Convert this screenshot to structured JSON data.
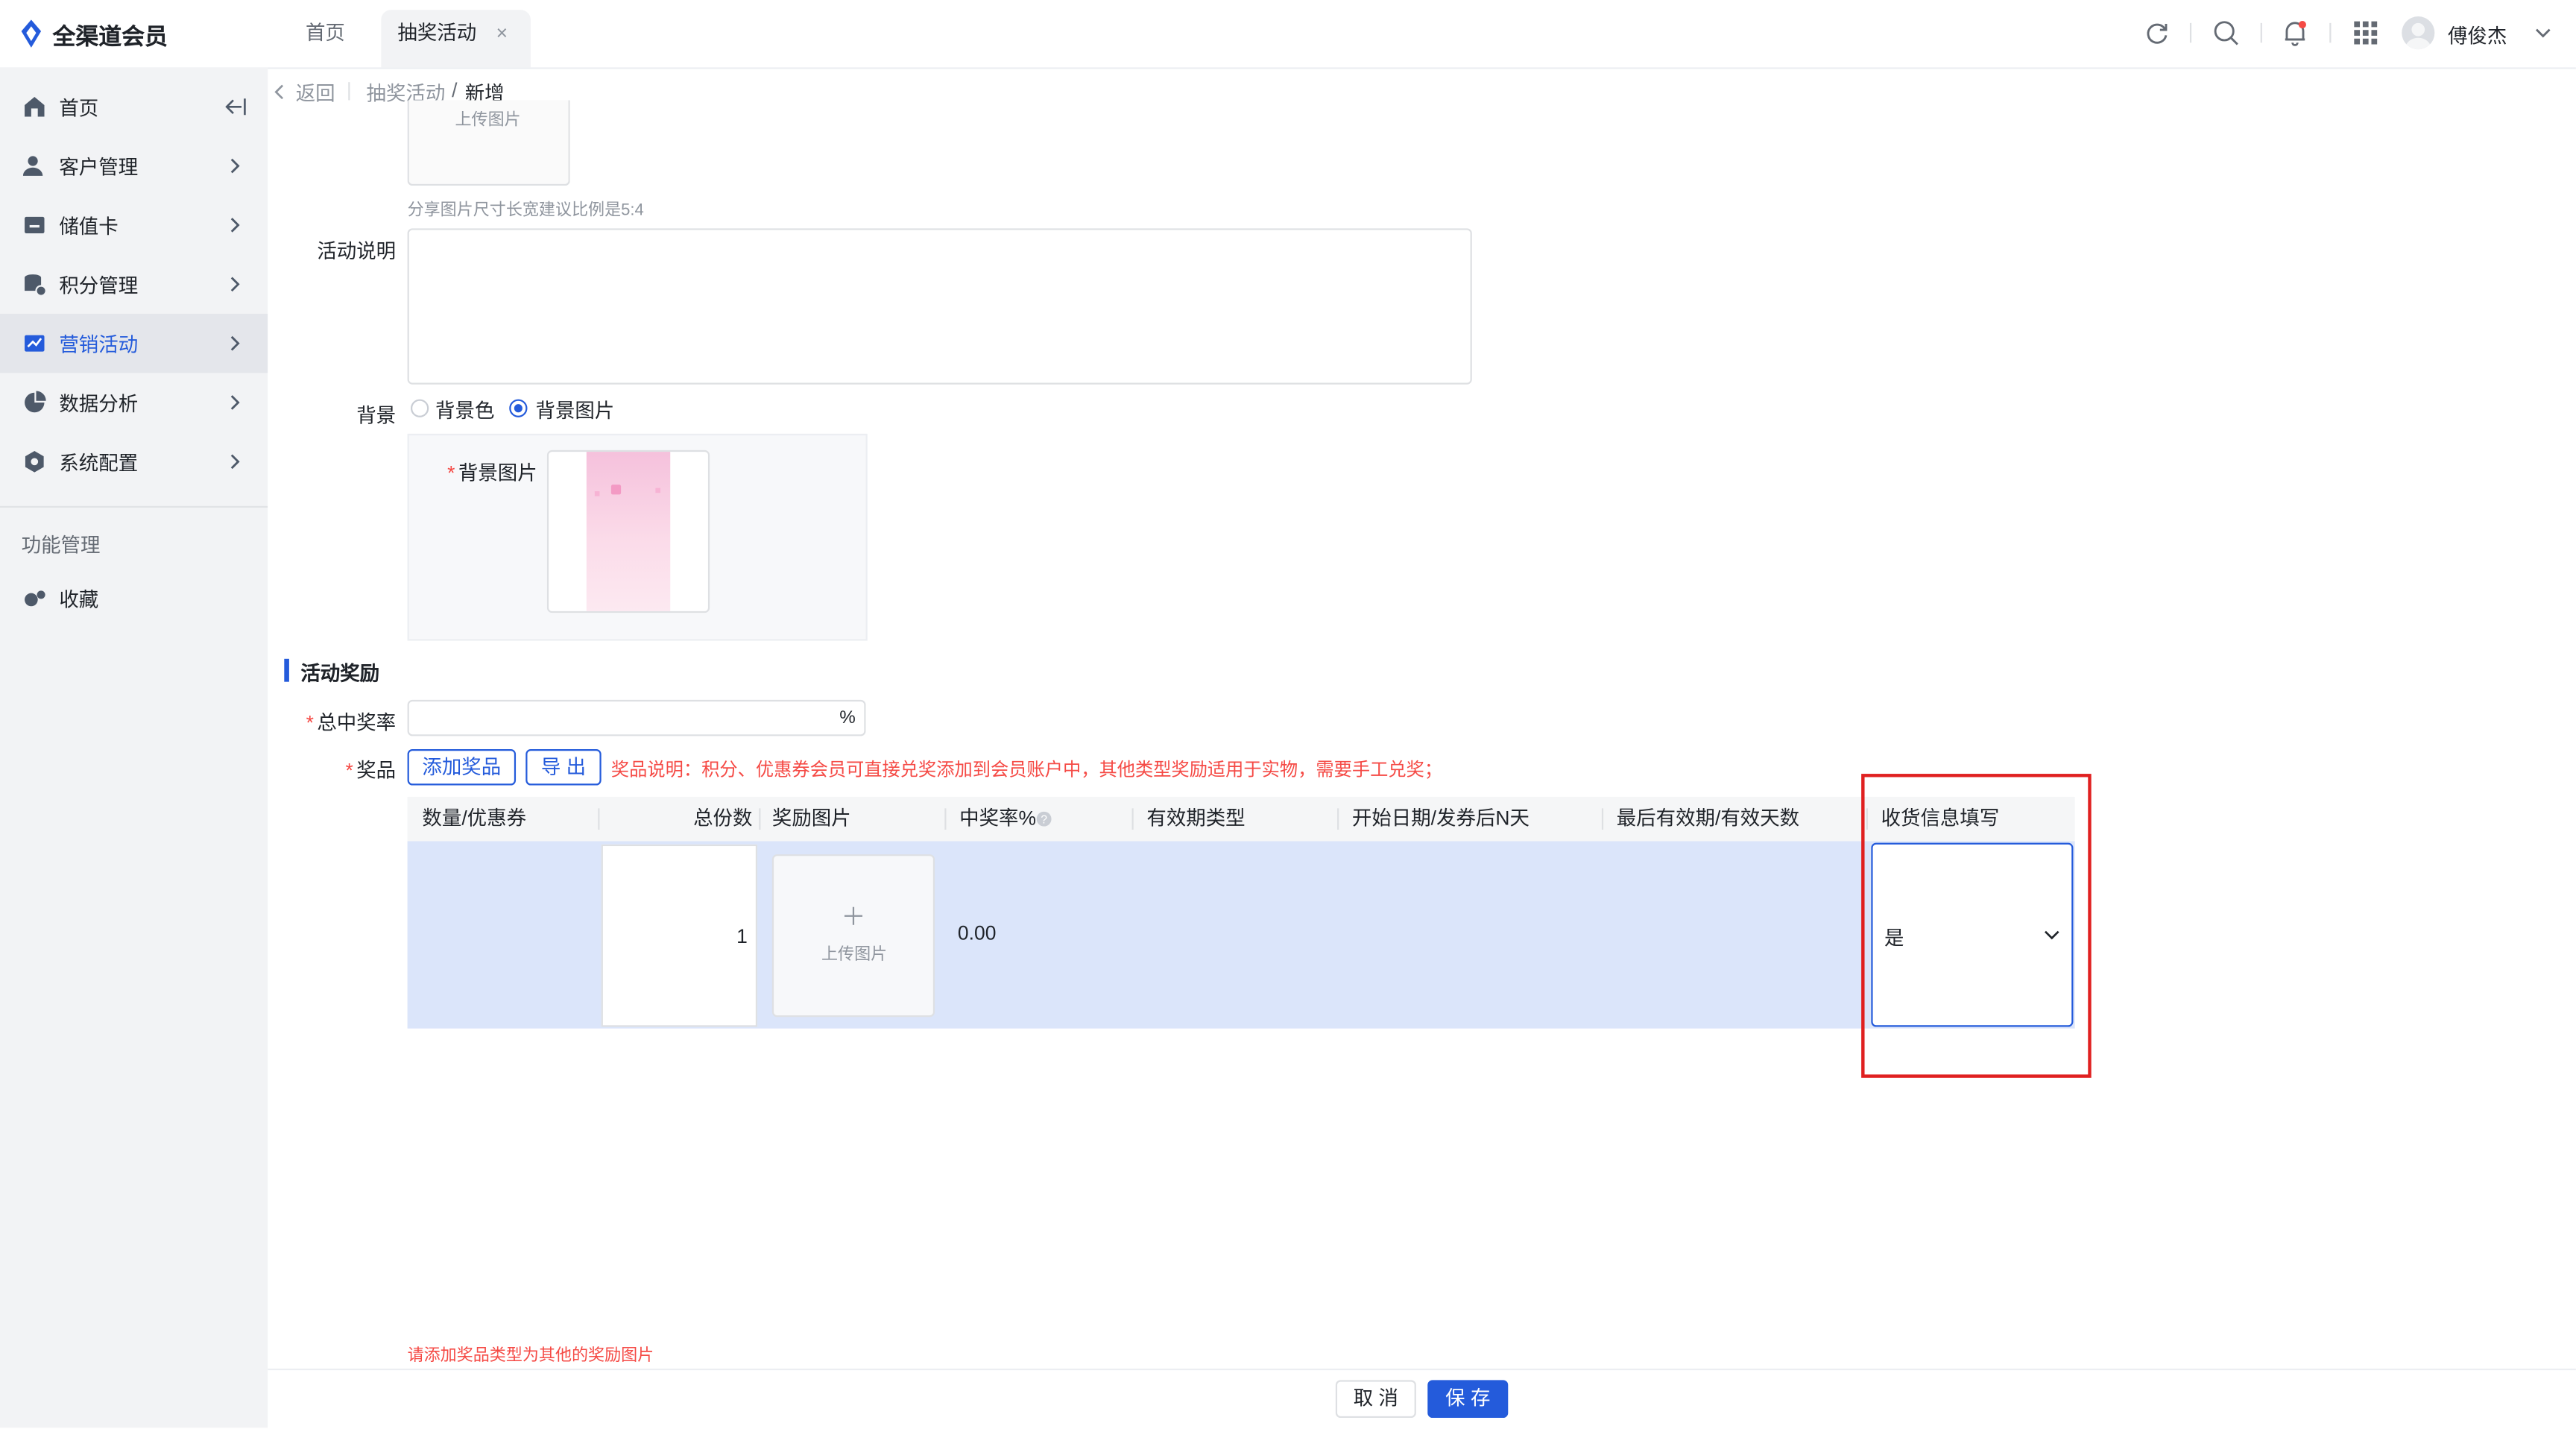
{
  "app": {
    "title": "全渠道会员"
  },
  "tabs": [
    {
      "label": "首页"
    },
    {
      "label": "抽奖活动",
      "close": "×"
    }
  ],
  "header": {
    "user_name": "傅俊杰"
  },
  "sidebar": {
    "items": [
      {
        "label": "首页",
        "icon": "home-icon"
      },
      {
        "label": "客户管理",
        "icon": "user-icon"
      },
      {
        "label": "储值卡",
        "icon": "card-icon"
      },
      {
        "label": "积分管理",
        "icon": "points-icon"
      },
      {
        "label": "营销活动",
        "icon": "marketing-icon",
        "active": true
      },
      {
        "label": "数据分析",
        "icon": "pie-icon"
      },
      {
        "label": "系统配置",
        "icon": "settings-icon"
      }
    ],
    "section_title": "功能管理",
    "favorites_label": "收藏"
  },
  "breadcrumb": {
    "back": "返回",
    "parent": "抽奖活动",
    "separator": "/",
    "current": "新增"
  },
  "form": {
    "share_upload_label": "上传图片",
    "share_hint": "分享图片尺寸长宽建议比例是5:4",
    "description_label": "活动说明",
    "background_label": "背景",
    "bg_option_color": "背景色",
    "bg_option_image": "背景图片",
    "bg_image_label": "背景图片",
    "reward_section_title": "活动奖励",
    "total_rate_label": "总中奖率",
    "total_rate_unit": "%",
    "prize_label": "奖品",
    "add_prize_button": "添加奖品",
    "export_button": "导 出",
    "prize_note": "奖品说明：积分、优惠券会员可直接兑奖添加到会员账户中，其他类型奖励适用于实物，需要手工兑奖；"
  },
  "table": {
    "columns": [
      "数量/优惠券",
      "总份数",
      "奖励图片",
      "中奖率%",
      "有效期类型",
      "开始日期/发券后N天",
      "最后有效期/有效天数",
      "收货信息填写"
    ],
    "rows": [
      {
        "total": "1",
        "image_upload": "上传图片",
        "rate": "0.00",
        "shipping_info": "是"
      }
    ]
  },
  "error_message": "请添加奖品类型为其他的奖励图片",
  "footer": {
    "cancel": "取 消",
    "save": "保 存"
  },
  "colors": {
    "primary": "#245bdb",
    "error": "#f54a45",
    "highlight": "#e02020",
    "row_selected": "#dbe5fa"
  }
}
